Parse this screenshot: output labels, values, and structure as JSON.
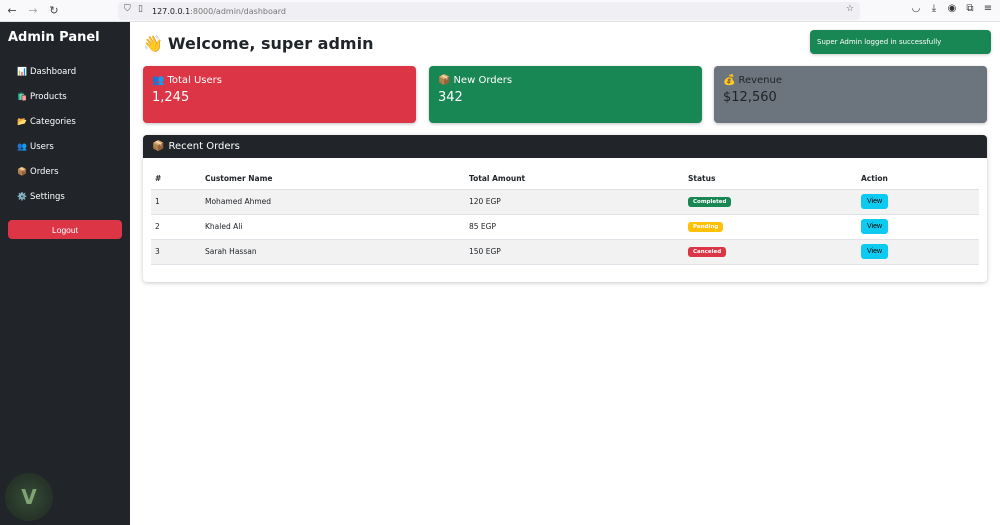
{
  "browser": {
    "url_host": "127.0.0.1",
    "url_path": ":8000/admin/dashboard"
  },
  "sidebar": {
    "brand": "Admin Panel",
    "items": [
      {
        "icon": "📊",
        "icon_name": "chart-icon",
        "label": "Dashboard"
      },
      {
        "icon": "🛍️",
        "icon_name": "shopping-bags-icon",
        "label": "Products"
      },
      {
        "icon": "📂",
        "icon_name": "folder-icon",
        "label": "Categories"
      },
      {
        "icon": "👥",
        "icon_name": "users-icon",
        "label": "Users"
      },
      {
        "icon": "📦",
        "icon_name": "package-icon",
        "label": "Orders"
      },
      {
        "icon": "⚙️",
        "icon_name": "gear-icon",
        "label": "Settings"
      }
    ],
    "logout_label": "Logout"
  },
  "header": {
    "wave": "👋",
    "welcome": "Welcome, super admin"
  },
  "toast": {
    "message": "Super Admin logged in successfully",
    "color": "#198754"
  },
  "stats": {
    "users": {
      "icon": "👥",
      "label": "Total Users",
      "value": "1,245",
      "color": "#dc3545"
    },
    "orders": {
      "icon": "📦",
      "label": "New Orders",
      "value": "342",
      "color": "#198754"
    },
    "revenue": {
      "icon": "💰",
      "label": "Revenue",
      "value": "$12,560",
      "color": "#6c757d"
    }
  },
  "recent_orders": {
    "icon": "📦",
    "title": "Recent Orders",
    "columns": [
      "#",
      "Customer Name",
      "Total Amount",
      "Status",
      "Action"
    ],
    "rows": [
      {
        "num": "1",
        "name": "Mohamed Ahmed",
        "amount": "120 EGP",
        "status": "Completed",
        "action": "View"
      },
      {
        "num": "2",
        "name": "Khaled Ali",
        "amount": "85 EGP",
        "status": "Pending",
        "action": "View"
      },
      {
        "num": "3",
        "name": "Sarah Hassan",
        "amount": "150 EGP",
        "status": "Canceled",
        "action": "View"
      }
    ]
  },
  "colors": {
    "sidebar_bg": "#212529",
    "danger": "#dc3545",
    "success": "#198754",
    "secondary": "#6c757d",
    "warning": "#ffc107",
    "info": "#0dcaf0"
  }
}
